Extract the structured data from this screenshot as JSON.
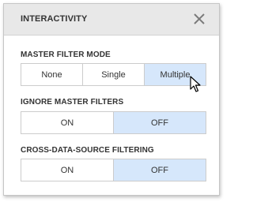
{
  "dialog": {
    "title": "INTERACTIVITY",
    "close_icon": "close-icon"
  },
  "sections": [
    {
      "label": "MASTER FILTER MODE",
      "options": [
        "None",
        "Single",
        "Multiple"
      ],
      "selected": "Multiple"
    },
    {
      "label": "IGNORE MASTER FILTERS",
      "options": [
        "ON",
        "OFF"
      ],
      "selected": "OFF"
    },
    {
      "label": "CROSS-DATA-SOURCE FILTERING",
      "options": [
        "ON",
        "OFF"
      ],
      "selected": "OFF"
    }
  ],
  "colors": {
    "selected_bg": "#d6e7fb",
    "header_bg": "#e8e8e8",
    "border": "#cccccc"
  }
}
